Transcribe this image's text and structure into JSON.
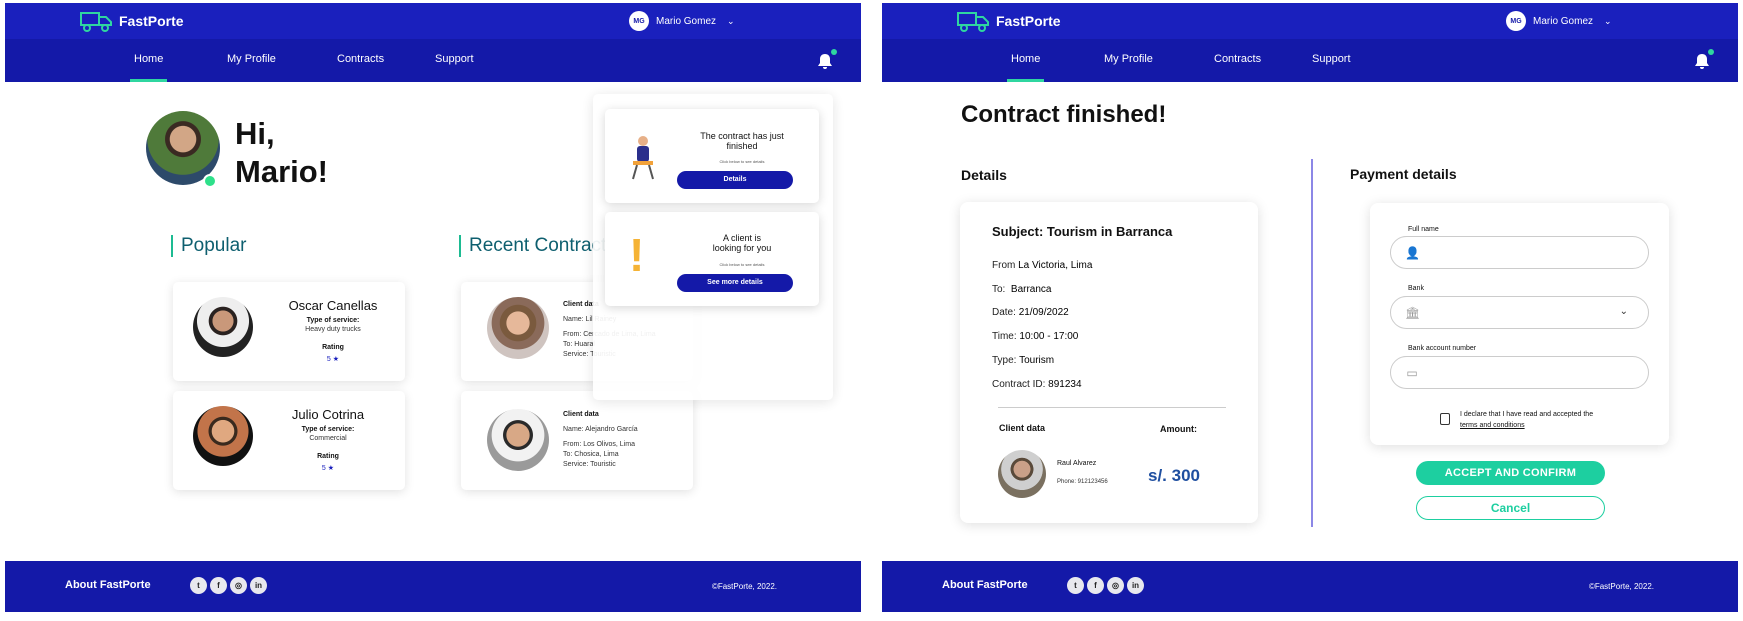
{
  "brand": {
    "name": "FastPorte",
    "accent": "#2fd6a0",
    "primary": "#1419a8"
  },
  "user": {
    "initials": "MG",
    "name": "Mario Gomez"
  },
  "nav": [
    {
      "label": "Home",
      "active": true
    },
    {
      "label": "My Profile",
      "active": false
    },
    {
      "label": "Contracts",
      "active": false
    },
    {
      "label": "Support",
      "active": false
    }
  ],
  "footer": {
    "about": "About FastPorte",
    "copyright": "©FastPorte, 2022.",
    "socials": [
      "twitter-icon",
      "facebook-icon",
      "instagram-icon",
      "linkedin-icon"
    ]
  },
  "home": {
    "greeting_line1": "Hi,",
    "greeting_line2": "Mario!",
    "popular_title": "Popular",
    "recent_title": "Recent Contracts",
    "popular": [
      {
        "name": "Oscar Canellas",
        "service_label": "Type of service:",
        "service": "Heavy duty trucks",
        "rating_label": "Rating",
        "rating": "5"
      },
      {
        "name": "Julio Cotrina",
        "service_label": "Type of service:",
        "service": "Commercial",
        "rating_label": "Rating",
        "rating": "5"
      }
    ],
    "recent": [
      {
        "title": "Client data",
        "name": "Name: Lil Rainey",
        "from": "From: Cercado de Lima, Lima",
        "to": "To: Huaral",
        "service": "Service: Touristic"
      },
      {
        "title": "Client data",
        "name": "Name: Alejandro García",
        "from": "From: Los Olivos, Lima",
        "to": "To: Chosica, Lima",
        "service": "Service: Touristic"
      }
    ],
    "notifications": [
      {
        "line1": "The contract has just",
        "line2": "finished",
        "sub": "Click below to see details",
        "button": "Details"
      },
      {
        "line1": "A client is",
        "line2": "looking for you",
        "sub": "Click below to see details",
        "button": "See more details"
      }
    ]
  },
  "finished": {
    "title": "Contract finished!",
    "details_title": "Details",
    "payment_title": "Payment details",
    "subject": "Subject: Tourism in Barranca",
    "rows": [
      {
        "label": "From",
        "value": "La Victoria, Lima"
      },
      {
        "label": "To:",
        "value": "Barranca"
      },
      {
        "label": "Date:",
        "value": "21/09/2022"
      },
      {
        "label": "Time:",
        "value": "10:00 - 17:00"
      },
      {
        "label": "Type:",
        "value": "Tourism"
      },
      {
        "label": "Contract ID:",
        "value": "891234"
      }
    ],
    "client_label": "Client data",
    "amount_label": "Amount:",
    "client_name": "Raul Alvarez",
    "client_phone": "Phone: 912123456",
    "amount": "s/. 300",
    "full_name_label": "Full name",
    "bank_label": "Bank",
    "account_label": "Bank account number",
    "declare": "I declare that I have read and accepted the",
    "terms": "terms and conditions",
    "accept_button": "ACCEPT AND CONFIRM",
    "cancel_button": "Cancel"
  }
}
